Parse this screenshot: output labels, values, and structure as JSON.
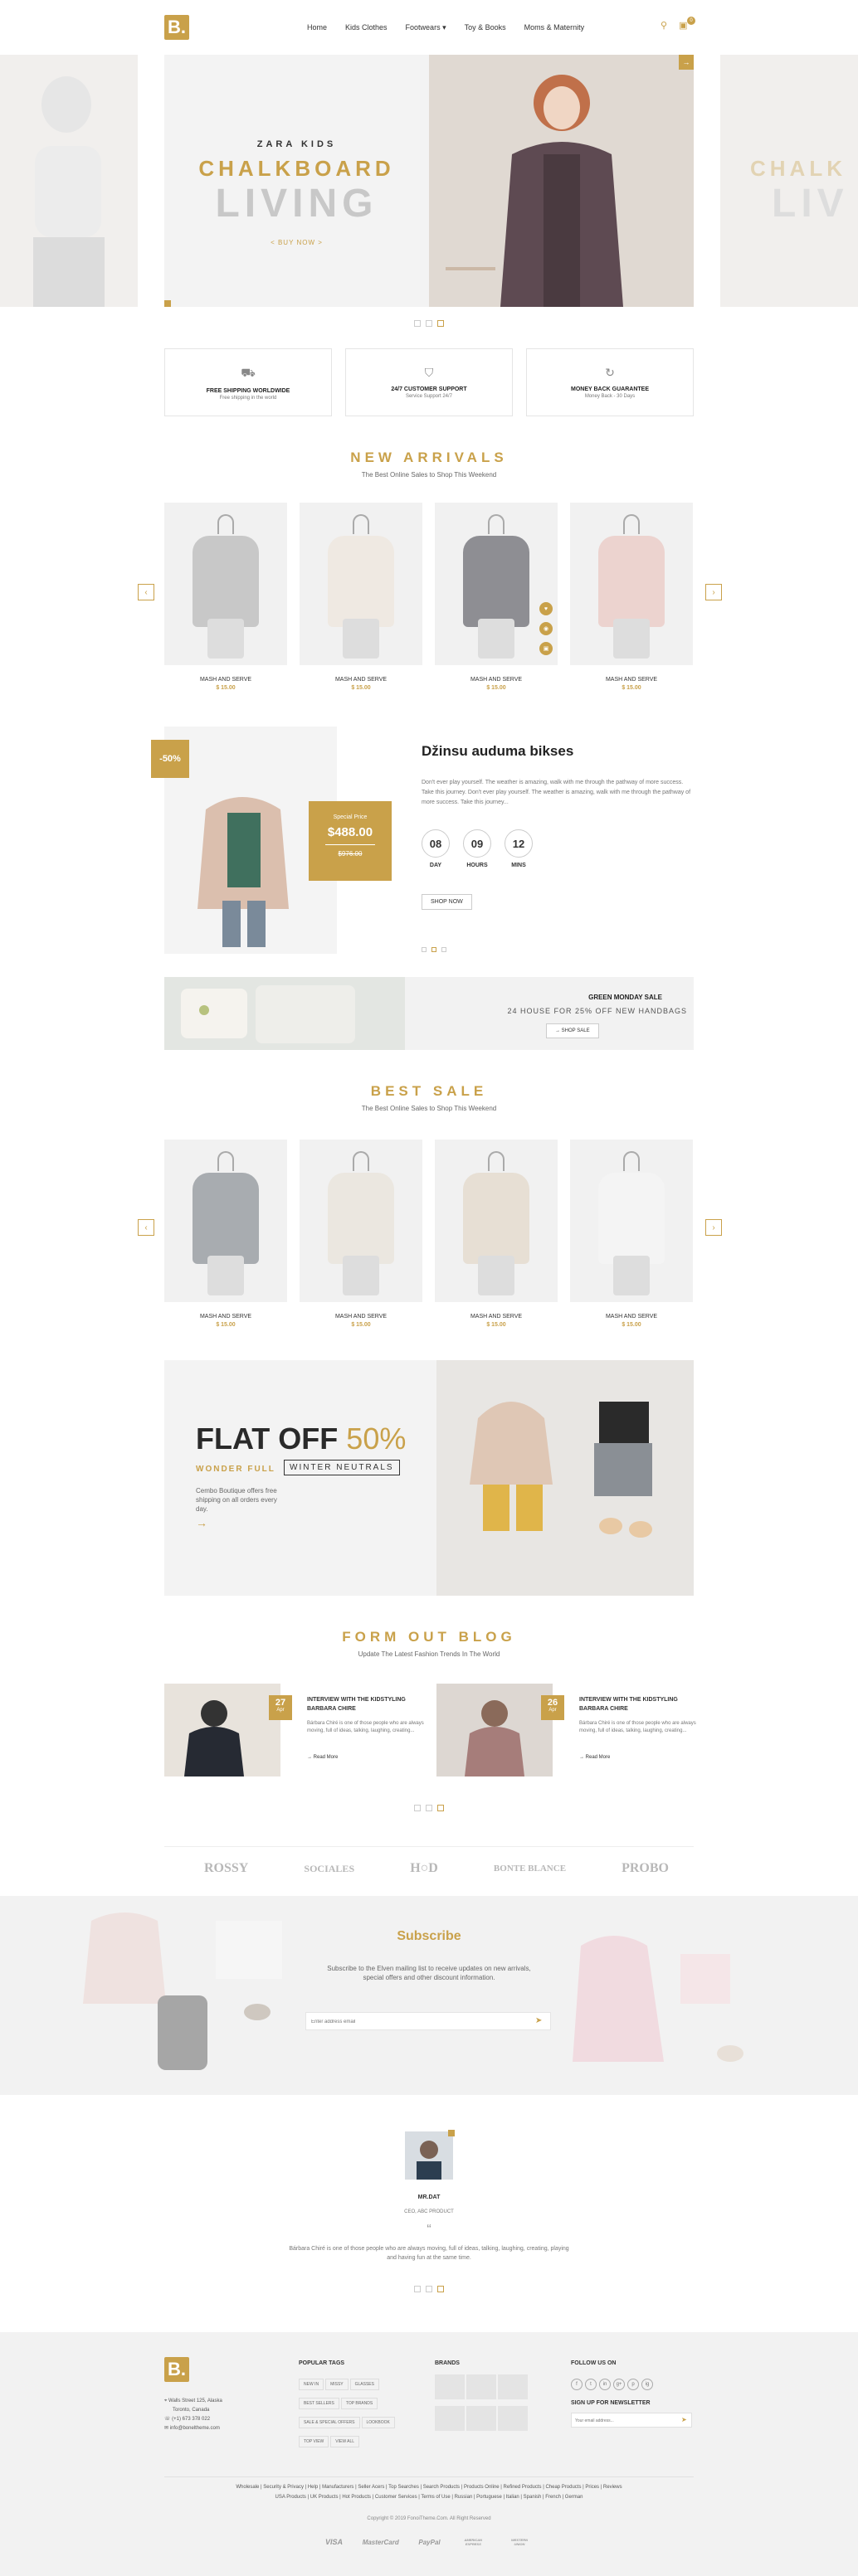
{
  "header": {
    "logo": "B.",
    "nav": [
      "Home",
      "Kids Clothes",
      "Footwears",
      "Toy & Books",
      "Moms & Maternity"
    ],
    "cart_count": "0"
  },
  "hero": {
    "kicker": "ZARA KIDS",
    "title": "CHALKBOARD",
    "subtitle": "LIVING",
    "cta": "< BUY NOW >",
    "side_title": "CHALK",
    "side_sub": "LIV"
  },
  "features": [
    {
      "icon": "truck-icon",
      "title": "FREE SHIPPING WORLDWIDE",
      "sub": "Free shipping in the world"
    },
    {
      "icon": "shield-icon",
      "title": "24/7 CUSTOMER SUPPORT",
      "sub": "Service Support 24/7"
    },
    {
      "icon": "refresh-icon",
      "title": "MONEY BACK GUARANTEE",
      "sub": "Money Back - 30 Days"
    }
  ],
  "new_arrivals": {
    "title": "NEW ARRIVALS",
    "sub": "The Best Online Sales to Shop This Weekend",
    "items": [
      {
        "name": "MASH AND SERVE",
        "price": "$ 15.00",
        "color": "#c8c8c8"
      },
      {
        "name": "MASH AND SERVE",
        "price": "$ 15.00",
        "color": "#efe9e2"
      },
      {
        "name": "MASH AND SERVE",
        "price": "$ 15.00",
        "color": "#8e8e93"
      },
      {
        "name": "MASH AND SERVE",
        "price": "$ 15.00",
        "color": "#ecd3cf"
      }
    ]
  },
  "deal": {
    "badge": "-50%",
    "special_label": "Special Price",
    "price": "$488.00",
    "old_price": "$976.00",
    "title": "Džinsu auduma bikses",
    "desc": "Don't ever play yourself. The weather is amazing, walk with me through the pathway of more success. Take this journey. Don't ever play yourself. The weather is amazing, walk with me through the pathway of more success. Take this journey...",
    "countdown": [
      {
        "v": "08",
        "l": "DAY"
      },
      {
        "v": "09",
        "l": "HOURS"
      },
      {
        "v": "12",
        "l": "MINS"
      }
    ],
    "cta": "SHOP NOW"
  },
  "banner": {
    "title": "GREEN MONDAY SALE",
    "sub": "24 HOUSE FOR 25% OFF NEW HANDBAGS",
    "cta": "→ SHOP SALE"
  },
  "best_sale": {
    "title": "BEST SALE",
    "sub": "The Best Online Sales to Shop This Weekend",
    "items": [
      {
        "name": "MASH AND SERVE",
        "price": "$ 15.00",
        "color": "#a8acb0"
      },
      {
        "name": "MASH AND SERVE",
        "price": "$ 15.00",
        "color": "#ebe7e0"
      },
      {
        "name": "MASH AND SERVE",
        "price": "$ 15.00",
        "color": "#e7dfd4"
      },
      {
        "name": "MASH AND SERVE",
        "price": "$ 15.00",
        "color": "#f4f4f4"
      }
    ]
  },
  "promo": {
    "flat": "FLAT OFF",
    "pct": "50%",
    "wonder": "WONDER FULL",
    "neutrals": "WINTER NEUTRALS",
    "desc": "Cembo Boutique offers free shipping on all orders every day.",
    "arrow": "→"
  },
  "blog": {
    "title": "FORM OUT BLOG",
    "sub": "Update The Latest Fashion Trends In The World",
    "posts": [
      {
        "day": "27",
        "month": "Apr",
        "title": "INTERVIEW WITH THE KIDSTYLING BARBARA CHIRE",
        "text": "Bárbara Chiré is one of those people who are always moving, full of ideas, talking, laughing, creating...",
        "more": "→ Read More"
      },
      {
        "day": "26",
        "month": "Apr",
        "title": "INTERVIEW WITH THE KIDSTYLING BARBARA CHIRE",
        "text": "Bárbara Chiré is one of those people who are always moving, full of ideas, talking, laughing, creating...",
        "more": "→ Read More"
      }
    ]
  },
  "brands": [
    "ROSSY",
    "SOCIALES",
    "H○D",
    "BONTE BLANCE",
    "PROBO"
  ],
  "subscribe": {
    "title": "Subscribe",
    "text": "Subscribe to the Elven mailing list to receive updates on new arrivals, special offers and other discount information.",
    "placeholder": "Enter address email"
  },
  "testimonial": {
    "name": "MR.DAT",
    "role": "CEO, ABC PRODUCT",
    "quote_mark": "“",
    "quote": "Bárbara Chiré is one of those people who are always moving, full of ideas, talking, laughing, creating, playing and having fun at the same time."
  },
  "footer": {
    "logo": "B.",
    "address": [
      "Walls Street 125, Alaska",
      "Toronto, Canada"
    ],
    "phone": "(+1) 673 378 022",
    "email": "info@boneltheme.com",
    "popular_title": "POPULAR TAGS",
    "tags": [
      "NEW IN",
      "MISSY",
      "GLASSES",
      "BEST SELLERS",
      "TOP BRANDS",
      "SALE & SPECIAL OFFERS",
      "LOOKBOOK",
      "TOP VIEW",
      "VIEW ALL"
    ],
    "brands_title": "BRANDS",
    "follow_title": "FOLLOW US ON",
    "social": [
      "f",
      "t",
      "in",
      "g+",
      "p",
      "ig"
    ],
    "newsletter_title": "SIGN UP FOR NEWSLETTER",
    "newsletter_placeholder": "Your email address...",
    "links1": "Wholesale | Security & Privacy | Help | Manufacturers | Seller Acers | Top Searches | Search Products | Products Online | Refined Products | Cheap Products | Prices | Reviews",
    "links2": "USA Products | UK Products | Hot Products | Customer Services | Terms of Use | Russian | Portuguese | Italian | Spanish | French | German",
    "copyright": "Copyright © 2019 FonoiTheme.Com. All Right Reserved",
    "payments": [
      "VISA",
      "MasterCard",
      "PayPal",
      "AMERICAN EXPRESS",
      "WESTERN UNION"
    ]
  },
  "colors": {
    "accent": "#c9a14a",
    "bg_light": "#f2f2f2"
  }
}
